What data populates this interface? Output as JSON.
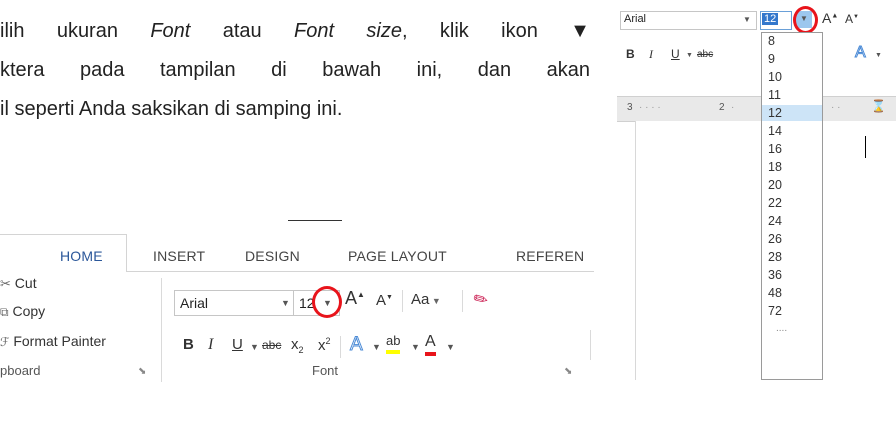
{
  "instruction": {
    "line1_a": "ilih ukuran ",
    "line1_b": "Font",
    "line1_c": " atau ",
    "line1_d": "Font size",
    "line1_e": ", klik ikon ▼",
    "line2": "ktera pada tampilan di bawah ini, dan akan",
    "line3": "il seperti Anda saksikan di samping ini."
  },
  "ribbon": {
    "tabs": [
      "HOME",
      "INSERT",
      "DESIGN",
      "PAGE LAYOUT",
      "REFEREN"
    ],
    "active_tab": "HOME",
    "clipboard": {
      "cut": "Cut",
      "copy": "Copy",
      "format_painter": "Format Painter",
      "group_label": "pboard",
      "scissors_icon": "scissors-icon",
      "copy_icon": "copy-icon",
      "brush_icon": "format-painter-icon"
    },
    "font": {
      "font_name": "Arial",
      "font_size": "12",
      "grow_label": "A",
      "shrink_label": "A",
      "case_label": "Aa",
      "bold": "B",
      "italic": "I",
      "underline": "U",
      "strike": "abc",
      "subscript": "x",
      "sub_mark": "2",
      "superscript": "x",
      "sup_mark": "2",
      "text_effects": "A",
      "highlight": "ab",
      "font_color": "A",
      "group_label": "Font"
    },
    "colors": {
      "accent": "#2b579a",
      "highlight_yellow": "#ffff00",
      "font_red": "#e8141b",
      "text_effects_blue": "#4a8ad6",
      "circle_red": "#e8141b"
    }
  },
  "word": {
    "font_name": "Arial",
    "font_size": "12",
    "bold": "B",
    "italic": "I",
    "underline": "U",
    "strike": "abc",
    "ruler": [
      "3",
      "2"
    ],
    "size_options": [
      "8",
      "9",
      "10",
      "11",
      "12",
      "14",
      "16",
      "18",
      "20",
      "22",
      "24",
      "26",
      "28",
      "36",
      "48",
      "72"
    ],
    "selected_size": "12",
    "more_indicator": "...."
  }
}
